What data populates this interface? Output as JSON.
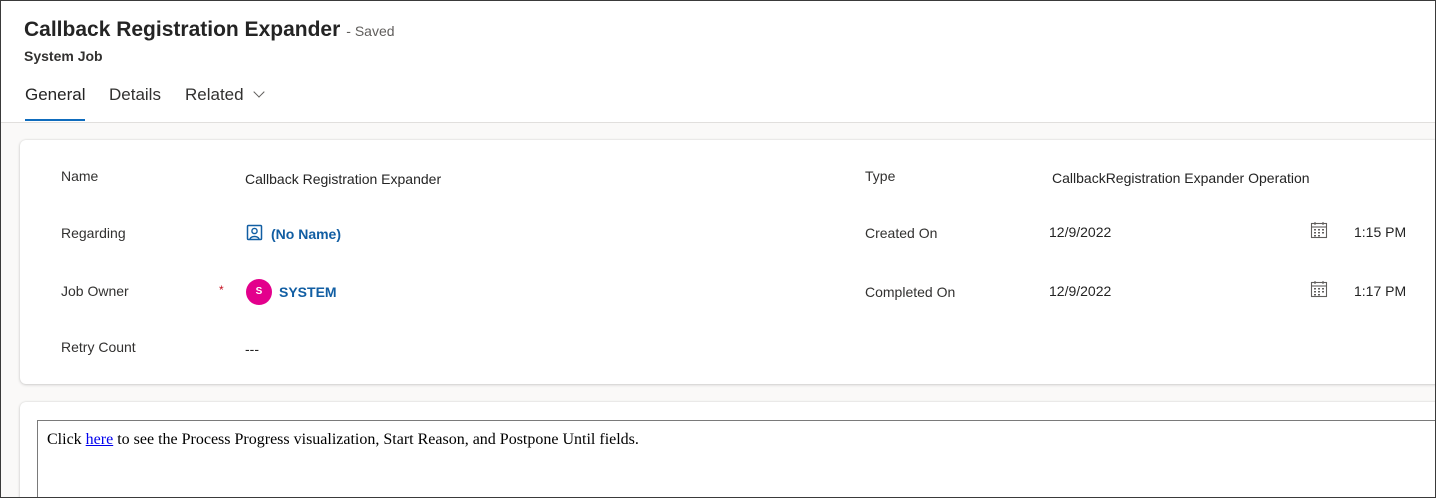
{
  "header": {
    "title": "Callback Registration Expander",
    "status": "- Saved",
    "entity": "System Job"
  },
  "tabs": [
    {
      "label": "General",
      "active": true
    },
    {
      "label": "Details",
      "active": false
    },
    {
      "label": "Related",
      "active": false
    }
  ],
  "fields": {
    "name": {
      "label": "Name",
      "value": "Callback Registration Expander"
    },
    "regarding": {
      "label": "Regarding",
      "value": "(No Name)"
    },
    "job_owner": {
      "label": "Job Owner",
      "required_mark": "*",
      "avatar_initial": "S",
      "value": "SYSTEM",
      "avatar_color": "#e3008c"
    },
    "retry_count": {
      "label": "Retry Count",
      "value": "---"
    },
    "type": {
      "label": "Type",
      "value": "CallbackRegistration Expander Operation"
    },
    "created_on": {
      "label": "Created On",
      "date": "12/9/2022",
      "time": "1:15 PM"
    },
    "completed_on": {
      "label": "Completed On",
      "date": "12/9/2022",
      "time": "1:17 PM"
    }
  },
  "notice": {
    "prefix": "Click",
    "link": "here",
    "suffix": "to see the Process Progress visualization, Start Reason, and Postpone Until fields."
  },
  "colors": {
    "link": "#115ea3",
    "accent": "#0f6cbd",
    "required": "#c50f1f"
  },
  "icons": {
    "regarding": "contact-card-icon",
    "calendar": "calendar-icon",
    "related_menu": "chevron-down-icon"
  }
}
